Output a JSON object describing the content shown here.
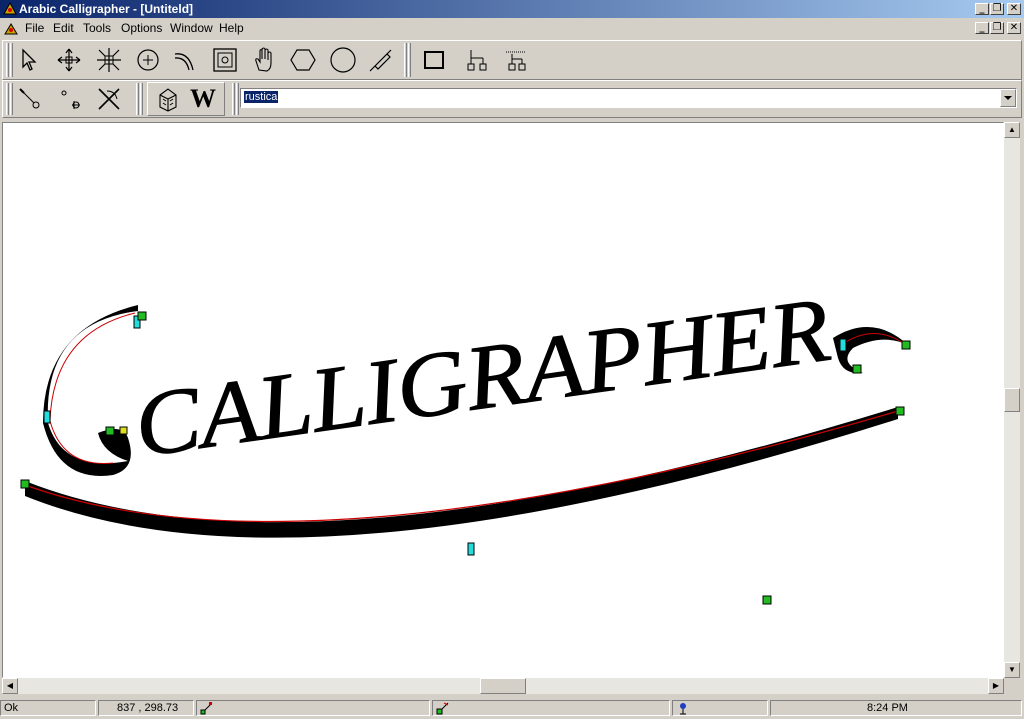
{
  "app": {
    "title": "Arabic Calligrapher - [Untiteld]",
    "window_controls": [
      "_",
      "❐",
      "✕"
    ],
    "child_controls": [
      "_",
      "❐",
      "✕"
    ]
  },
  "menu": {
    "items": [
      "File",
      "Edit",
      "Tools",
      "Options",
      "Window",
      "Help"
    ]
  },
  "toolbar1": {
    "icons": [
      "select-arrow-icon",
      "move-icon",
      "resize-icon",
      "circle-cross-icon",
      "curve-icon",
      "frame-icon",
      "pan-hand-icon",
      "hexagon-icon",
      "circle-icon",
      "pen-nib-icon",
      "rectangle-icon",
      "tree-icon",
      "dotted-tree-icon"
    ]
  },
  "toolbar2": {
    "icons": [
      "add-node-icon",
      "remove-node-icon",
      "scissors-icon",
      "stamp-icon"
    ],
    "w_label": "W",
    "font_combo": {
      "value": "rustica"
    }
  },
  "canvas": {
    "text": "CALLIGRAPHER",
    "colors": {
      "ink": "#000000",
      "guide": "#cc0000",
      "handle_green": "#22bb22",
      "handle_cyan": "#22dddd",
      "handle_yellow": "#dddd22"
    }
  },
  "status": {
    "message": "Ok",
    "coordinates": "837 , 298.73",
    "time": "8:24 PM"
  }
}
